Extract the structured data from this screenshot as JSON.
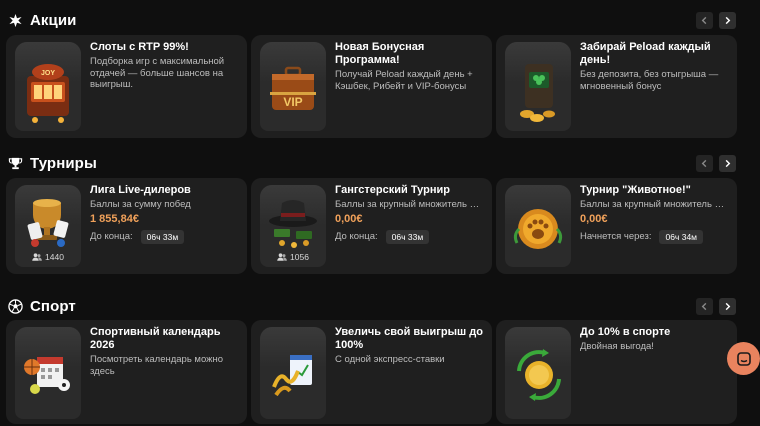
{
  "sections": {
    "promos": {
      "title": "Акции",
      "cards": [
        {
          "title": "Слоты с RTP 99%!",
          "desc": "Подборка игр с максимальной отдачей — больше шансов на выигрыш.",
          "art_text": "JOY"
        },
        {
          "title": "Новая Бонусная Программа!",
          "desc": "Получай Реload каждый день + Кэшбек, Рибейт и VIP-бонусы",
          "art_text": "VIP"
        },
        {
          "title": "Забирай Реload каждый день!",
          "desc": "Без депозита, без отыгрыша — мгновенный бонус"
        }
      ]
    },
    "tournaments": {
      "title": "Турниры",
      "cards": [
        {
          "title": "Лига Live-дилеров",
          "desc": "Баллы за сумму побед",
          "amount": "1 855,84€",
          "end_label": "До конца:",
          "timer": "06ч 33м",
          "players": "1440"
        },
        {
          "title": "Гангстерский Турнир",
          "desc": "Баллы за крупный множитель выигрыша",
          "amount": "0,00€",
          "end_label": "До конца:",
          "timer": "06ч 33м",
          "players": "1056"
        },
        {
          "title": "Турнир \"Животное!\"",
          "desc": "Баллы за крупный множитель выигрыша",
          "amount": "0,00€",
          "end_label": "Начнется через:",
          "timer": "06ч 34м"
        }
      ]
    },
    "sport": {
      "title": "Спорт",
      "cards": [
        {
          "title": "Спортивный календарь 2026",
          "desc": "Посмотреть календарь можно здесь"
        },
        {
          "title": "Увеличь свой выигрыш до 100%",
          "desc": "С одной экспресс-ставки"
        },
        {
          "title": "До 10% в спорте",
          "desc": "Двойная выгода!"
        }
      ]
    }
  },
  "colors": {
    "background": "#0f0f0f",
    "card": "#1f1f1f",
    "amount": "#f0a15a",
    "chat": "#e9835e"
  },
  "icons": {
    "promos": "star-burst-icon",
    "tournaments": "trophy-icon",
    "sport": "soccer-ball-icon",
    "arrow_prev": "chevron-left-icon",
    "arrow_next": "chevron-right-icon",
    "players": "users-icon",
    "chat": "chat-icon"
  }
}
